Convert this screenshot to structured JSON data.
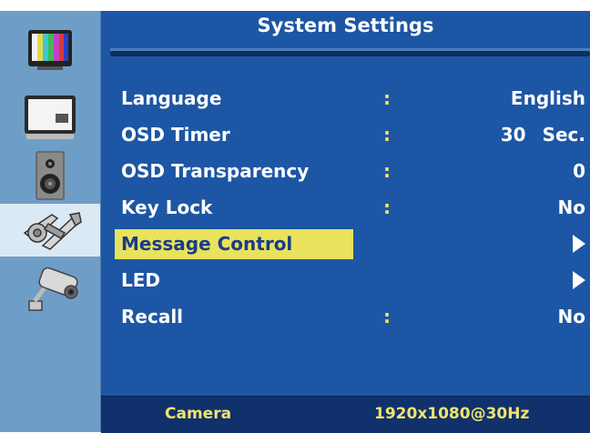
{
  "title": "System Settings",
  "sidebar": {
    "items": [
      {
        "name": "picture",
        "icon": "tv-color-bars-icon"
      },
      {
        "name": "display",
        "icon": "monitor-icon"
      },
      {
        "name": "audio",
        "icon": "speaker-icon"
      },
      {
        "name": "system",
        "icon": "tools-icon",
        "selected": true
      },
      {
        "name": "camera",
        "icon": "cctv-camera-icon"
      }
    ]
  },
  "menu": {
    "colon": ":",
    "items": [
      {
        "label": "Language",
        "value": "English"
      },
      {
        "label": "OSD Timer",
        "value": "30",
        "unit": "Sec."
      },
      {
        "label": "OSD Transparency",
        "value": "0"
      },
      {
        "label": "Key Lock",
        "value": "No"
      },
      {
        "label": "Message Control",
        "submenu": true,
        "highlighted": true
      },
      {
        "label": "LED",
        "submenu": true
      },
      {
        "label": "Recall",
        "value": "No"
      }
    ]
  },
  "status": {
    "source": "Camera",
    "resolution": "1920x1080@30Hz"
  },
  "colors": {
    "background": "#1d56a4",
    "sidebar": "#6e9ec7",
    "highlight": "#e7e35c",
    "accent_text": "#f1e46a",
    "status_bar": "#10316c"
  }
}
